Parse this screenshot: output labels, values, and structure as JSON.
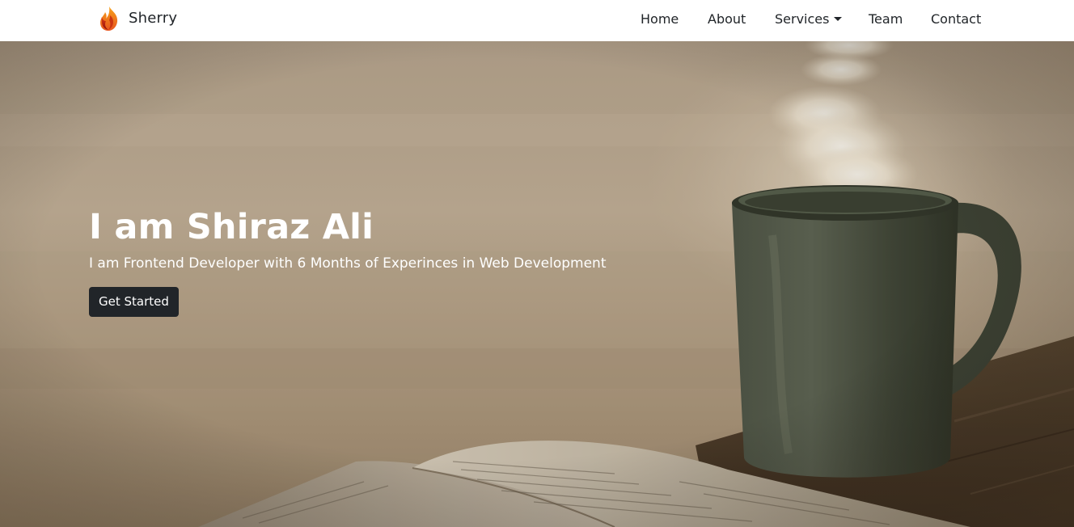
{
  "navbar": {
    "brand_name": "Sherry",
    "logo_icon": "flame-icon",
    "links": {
      "home": "Home",
      "about": "About",
      "services": "Services",
      "team": "Team",
      "contact": "Contact"
    }
  },
  "hero": {
    "title": "I am Shiraz Ali",
    "subtitle": "I am Frontend Developer with 6 Months of Experinces in Web Development",
    "cta_label": "Get Started",
    "background_image": "coffee-mug-and-open-book-by-water"
  },
  "colors": {
    "navbar_bg": "#ffffff",
    "nav_text": "#212529",
    "button_bg": "#212529",
    "hero_text": "#ffffff",
    "logo_orange": "#e8541e",
    "logo_red": "#b3170f"
  }
}
